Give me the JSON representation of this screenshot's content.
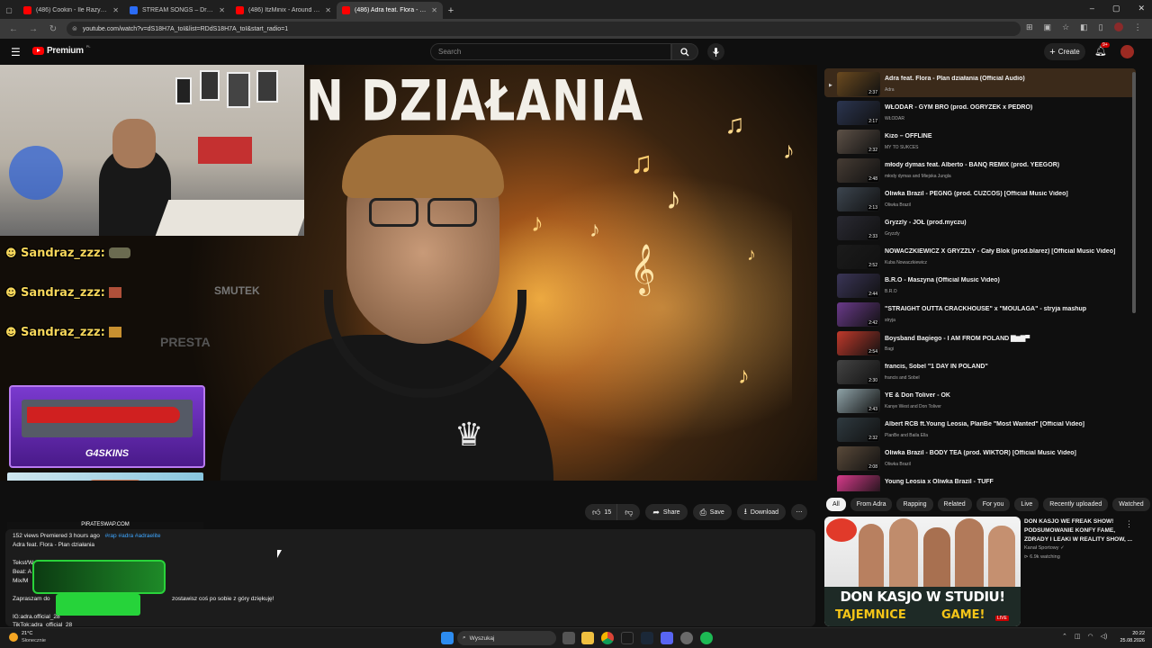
{
  "tabs": [
    {
      "title": "(486) Cookin - Ile Razy? - YouTube",
      "favicon_color": "#ff0000",
      "active": false
    },
    {
      "title": "STREAM SONGS – Dropbox",
      "favicon_color": "#2b6cf6",
      "active": false
    },
    {
      "title": "(486) ItzMinix - Around Me (Off…",
      "favicon_color": "#ff0000",
      "active": false
    },
    {
      "title": "(486) Adra feat. Flora - Plan dz…",
      "favicon_color": "#ff0000",
      "active": true
    }
  ],
  "address": {
    "url": "youtube.com/watch?v=dS18H7A_toI&list=RDdS18H7A_toI&start_radio=1"
  },
  "header": {
    "logo_text": "Premium",
    "logo_badge": "PL",
    "search_placeholder": "Search",
    "create_label": "Create",
    "notif_count": "9+"
  },
  "video": {
    "poster_title": "N DZIAŁANIA",
    "chat": [
      {
        "user": "Sandraz_zzz:"
      },
      {
        "user": "Sandraz_zzz:"
      },
      {
        "user": "Sandraz_zzz:"
      }
    ],
    "bg_words": [
      "SMUTEK",
      "PRESTA"
    ],
    "ad1_brand": "G4SKINS",
    "ad2_brand": "PIRATESWAP.COM"
  },
  "actions": {
    "like_count": "15",
    "share": "Share",
    "save": "Save",
    "download": "Download"
  },
  "description": {
    "meta": "152 views  Premiered 3 hours ago",
    "tags": "#rap #adra #adraelite",
    "title": "Adra feat. Flora - Plan działania",
    "line1": "Tekst/W",
    "line2": "Beat: A",
    "line3": "Mix/M",
    "line4_start": "Zapraszam do",
    "line4_end": "zostawisz coś po sobie z góry dziękuję!",
    "line5": "IG:adra.official_28",
    "line6": "TikTok:adra_official_28"
  },
  "playlist": [
    {
      "title": "Adra feat. Flora - Plan działania (Official Audio)",
      "channel": "Adra",
      "duration": "2:37",
      "color": "#6b4a1f",
      "playing": true
    },
    {
      "title": "WŁODAR - GYM BRO (prod. OGRYZEK x PEDRO)",
      "channel": "WŁODAR",
      "duration": "2:17",
      "color": "#2b3550"
    },
    {
      "title": "Kizo – OFFLINE",
      "channel": "MY TO SUKCES",
      "duration": "2:32",
      "color": "#5d5147"
    },
    {
      "title": "młody dymas feat. Alberto - BANQ REMIX (prod. YEEGOR)",
      "channel": "młody dymas and Miejska Jungla",
      "duration": "2:48",
      "color": "#463c34"
    },
    {
      "title": "Oliwka Brazil - PEGNG (prod. CUZCOS) [Official Music Video]",
      "channel": "Oliwka Brazil",
      "duration": "2:13",
      "color": "#3d4650"
    },
    {
      "title": "Gryzzly - JOŁ (prod.myczu)",
      "channel": "Gryzzly",
      "duration": "2:33",
      "color": "#2a2a33"
    },
    {
      "title": "NOWACZKIEWICZ X GRYZZLY - Cały Blok (prod.blarez) [Official Music Video]",
      "channel": "Kuba Nowaczkiewicz",
      "duration": "2:52",
      "color": "#1b1b1b"
    },
    {
      "title": "B.R.O - Maszyna (Official Music Video)",
      "channel": "B.R.O",
      "duration": "2:44",
      "color": "#3a3557"
    },
    {
      "title": "\"STRAIGHT OUTTA CRACKHOUSE\" x \"MOULAGA\" - stryja mashup",
      "channel": "stryja",
      "duration": "2:42",
      "color": "#6a3a8a"
    },
    {
      "title": "Boysband Bagiego - I AM FROM POLAND ▇▆▇▀",
      "channel": "Bagi",
      "duration": "2:54",
      "color": "#c0392b"
    },
    {
      "title": "francis, Sobel \"1 DAY IN POLAND\"",
      "channel": "francis and Sobel",
      "duration": "2:30",
      "color": "#444"
    },
    {
      "title": "YE & Don Toliver - OK",
      "channel": "Kanye West and Don Toliver",
      "duration": "2:43",
      "color": "#8fa3a8"
    },
    {
      "title": "Albert RCB ft.Young Leosia, PlanBe \"Most Wanted\" [Official Video]",
      "channel": "PlanBe and Baila Ella",
      "duration": "2:32",
      "color": "#2f3a40"
    },
    {
      "title": "Oliwka Brazil - BODY TEA (prod. WIKTOR) [Official Music Video]",
      "channel": "Oliwka Brazil",
      "duration": "2:08",
      "color": "#5a4a3a"
    },
    {
      "title": "Young Leosia x Oliwka Brazil - TUFF",
      "channel": "",
      "duration": "",
      "color": "#d63a8a"
    }
  ],
  "chips": [
    "All",
    "From Adra",
    "Rapping",
    "Related",
    "For you",
    "Live",
    "Recently uploaded",
    "Watched"
  ],
  "rec": {
    "title": "DON KASJO WE FREAK SHOW! PODSUMOWANIE KONFY FAME, ZDRADY I LEAKI W REALITY SHOW, ...",
    "channel": "Kanał Sportowy",
    "watching": "6.9k watching",
    "thumb_text1": "DON KASJO W STUDIU!",
    "thumb_text2": "TAJEMNICE",
    "thumb_text3": "GAME!",
    "live_badge": "LIVE"
  },
  "taskbar": {
    "weather_temp": "21°C",
    "weather_desc": "Słonecznie",
    "search_label": "Wyszukaj",
    "time": "20:22",
    "date": "25.08.2026"
  }
}
